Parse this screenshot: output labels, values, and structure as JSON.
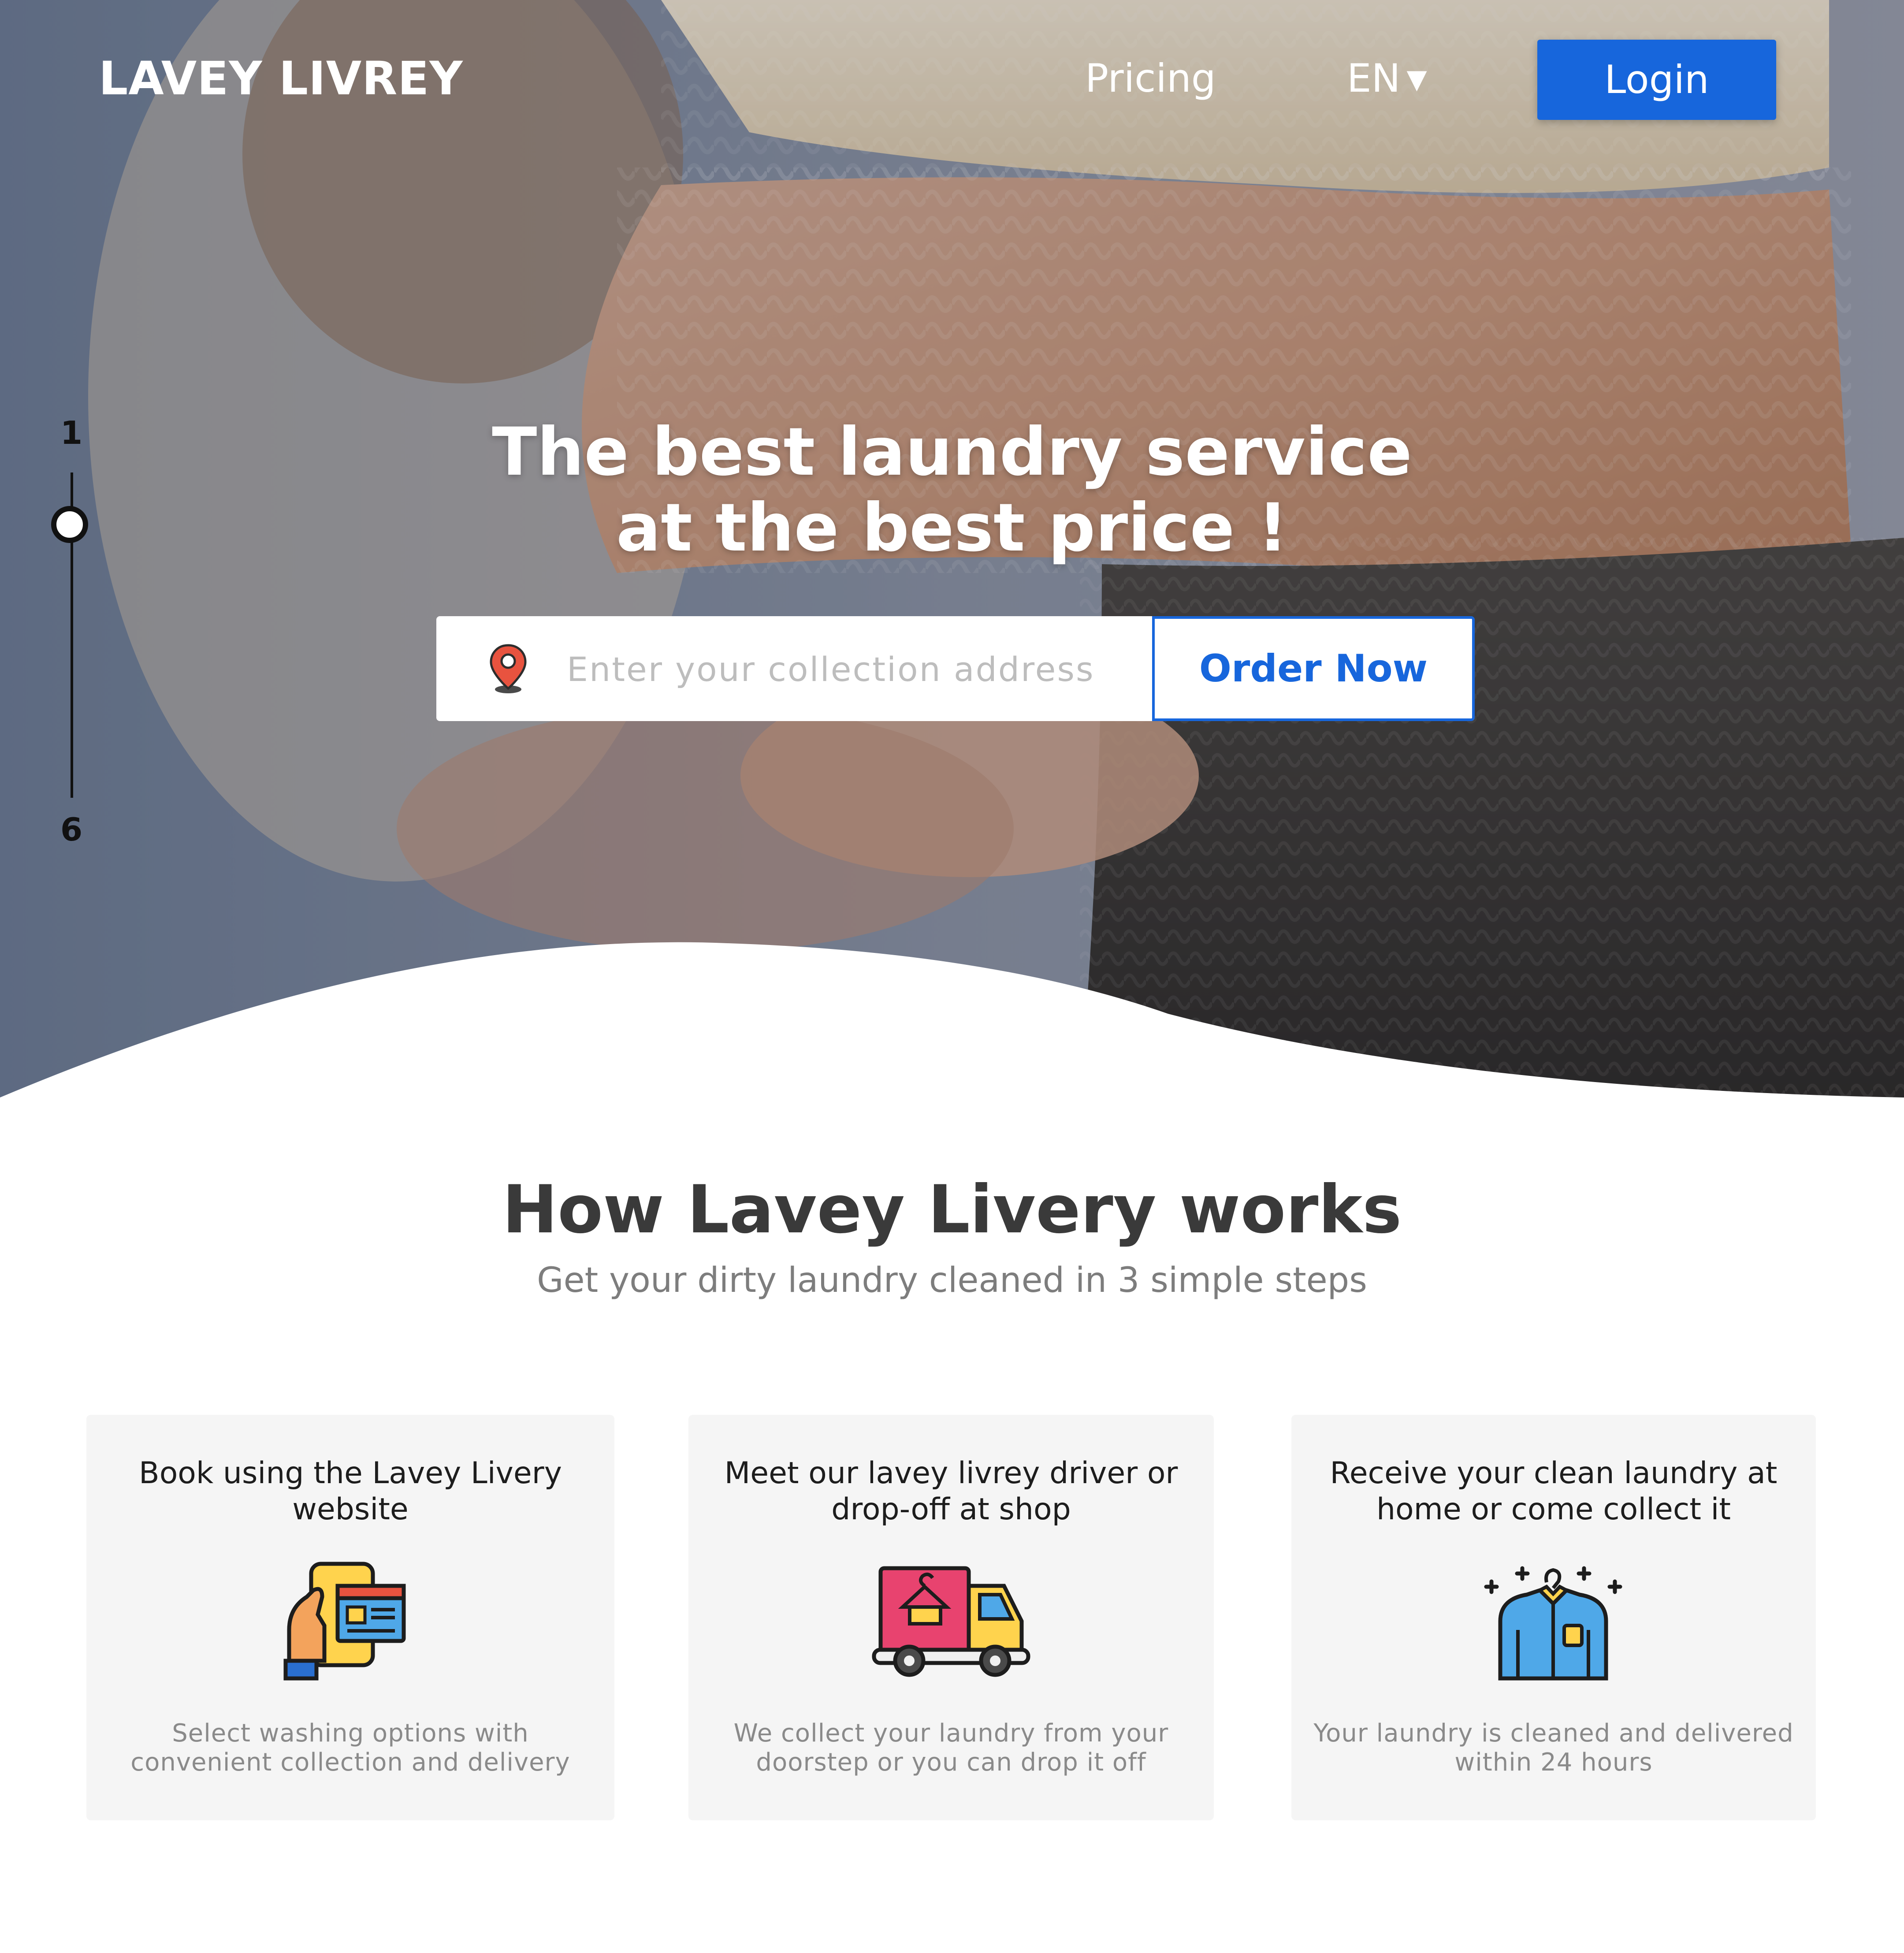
{
  "header": {
    "brand": "LAVEY LIVREY",
    "nav_pricing": "Pricing",
    "nav_language": "EN",
    "language_caret_icon": "caret-down-icon",
    "login_label": "Login"
  },
  "hero": {
    "slide_indicator": {
      "top_label": "1",
      "bottom_label": "6",
      "current": 1,
      "total": 6
    },
    "title_line1": "The best laundry service",
    "title_line2": "at the best price !",
    "address_placeholder": "Enter your collection address",
    "address_value": "",
    "address_icon": "location-pin-icon",
    "order_label": "Order Now"
  },
  "how": {
    "title": "How Lavey Livery works",
    "subtitle": "Get your dirty laundry cleaned in 3 simple steps",
    "steps": [
      {
        "title": "Book using the Lavey Livery website",
        "icon": "phone-booking-icon",
        "description": "Select washing options with convenient collection and delivery"
      },
      {
        "title": "Meet our lavey livrey driver or drop-off at shop",
        "icon": "delivery-truck-icon",
        "description": "We collect your laundry from your doorstep or you can drop it off"
      },
      {
        "title": "Receive your clean laundry at home or come collect it",
        "icon": "clean-shirt-icon",
        "description": "Your laundry is cleaned and delivered within 24 hours"
      }
    ]
  },
  "colors": {
    "accent": "#1766dc",
    "card_bg": "#f5f5f5",
    "heading": "#3a3a3a",
    "muted": "#8a8a8a"
  }
}
